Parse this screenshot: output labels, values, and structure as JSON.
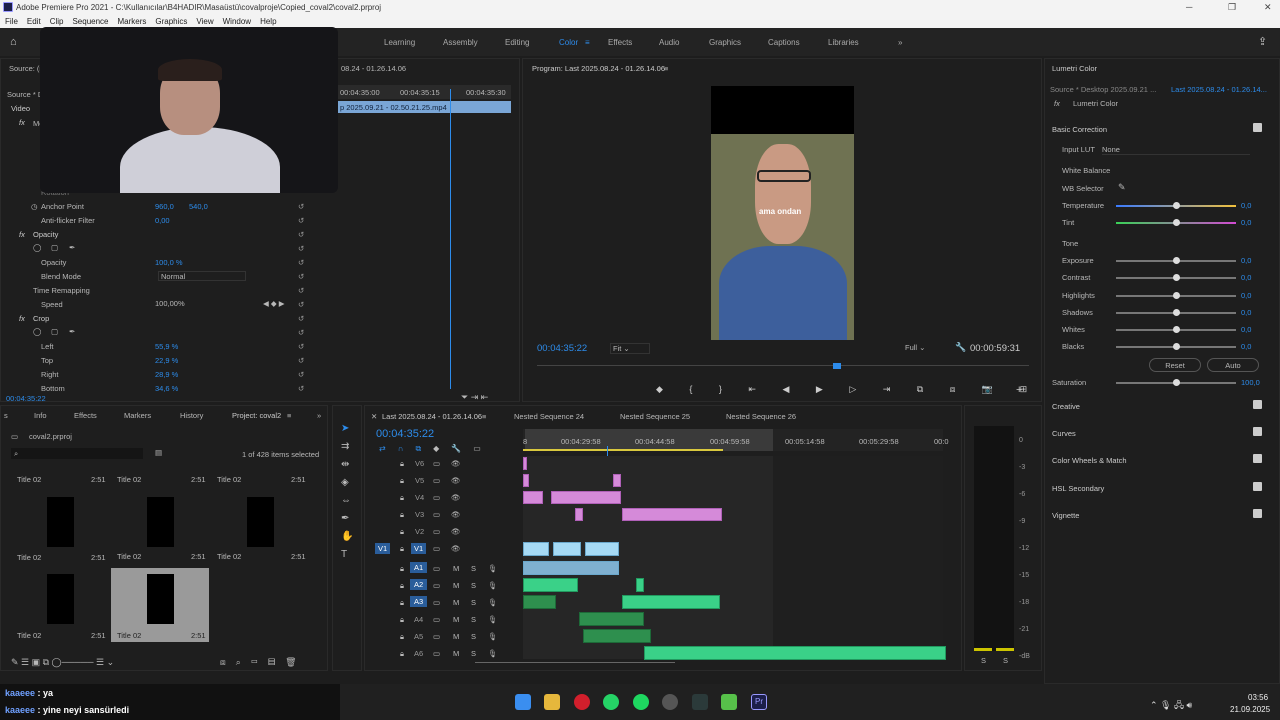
{
  "titlebar": {
    "title": "Adobe Premiere Pro 2021 - C:\\Kullanıcılar\\B4HADIR\\Masaüstü\\covalproje\\Copied_coval2\\coval2.prproj"
  },
  "menu": [
    "File",
    "Edit",
    "Clip",
    "Sequence",
    "Markers",
    "Graphics",
    "View",
    "Window",
    "Help"
  ],
  "workspaces": [
    "Learning",
    "Assembly",
    "Editing",
    "Color",
    "Effects",
    "Audio",
    "Graphics",
    "Captions",
    "Libraries"
  ],
  "effect_controls": {
    "source": "Source: (n",
    "source2": "Source * D",
    "video": "Video",
    "fx_motion": "Mo",
    "rotation": "Rotation",
    "anchor_point": "Anchor Point",
    "anchor_x": "960,0",
    "anchor_y": "540,0",
    "anti_flicker": "Anti-flicker Filter",
    "anti_flicker_val": "0,00",
    "opacity": "Opacity",
    "opacity_sub": "Opacity",
    "opacity_val": "100,0 %",
    "blend_mode": "Blend Mode",
    "blend_val": "Normal",
    "time_remap": "Time Remapping",
    "speed": "Speed",
    "speed_val": "100,00%",
    "crop": "Crop",
    "left": "Left",
    "left_val": "55,9 %",
    "top": "Top",
    "top_val": "22,9 %",
    "right": "Right",
    "right_val": "28,9 %",
    "bottom": "Bottom",
    "bottom_val": "34,6 %",
    "timecode": "00:04:35:22",
    "mini_tc": "08.24 - 01.26.14.06",
    "mini_t1": "00:04:35:00",
    "mini_t2": "00:04:35:15",
    "mini_t3": "00:04:35:30",
    "mini_clip": "p 2025.09.21 - 02.50.21.25.mp4"
  },
  "program": {
    "title": "Program: Last 2025.08.24 - 01.26.14.06",
    "caption": "ama ondan",
    "timecode": "00:04:35:22",
    "fit": "Fit",
    "quality": "Full",
    "duration": "00:00:59:31"
  },
  "lumetri": {
    "title": "Lumetri Color",
    "source": "Source * Desktop 2025.09.21 ...",
    "seq": "Last 2025.08.24 - 01.26.14...",
    "effect": "Lumetri Color",
    "basic": "Basic Correction",
    "lut": "Input LUT",
    "lut_val": "None",
    "wb": "White Balance",
    "wb_sel": "WB Selector",
    "temperature": "Temperature",
    "temp_val": "0,0",
    "tint": "Tint",
    "tint_val": "0,0",
    "tone": "Tone",
    "exposure": "Exposure",
    "exposure_val": "0,0",
    "contrast": "Contrast",
    "contrast_val": "0,0",
    "highlights": "Highlights",
    "highlights_val": "0,0",
    "shadows": "Shadows",
    "shadows_val": "0,0",
    "whites": "Whites",
    "whites_val": "0,0",
    "blacks": "Blacks",
    "blacks_val": "0,0",
    "reset": "Reset",
    "auto": "Auto",
    "saturation": "Saturation",
    "saturation_val": "100,0",
    "sections": [
      "Creative",
      "Curves",
      "Color Wheels & Match",
      "HSL Secondary",
      "Vignette"
    ]
  },
  "project": {
    "tabs": [
      "s",
      "Info",
      "Effects",
      "Markers",
      "History",
      "Project: coval2"
    ],
    "file": "coval2.prproj",
    "count": "1 of 428 items selected",
    "items": [
      {
        "name": "Title 02",
        "dur": "2:51"
      },
      {
        "name": "Title 02",
        "dur": "2:51"
      },
      {
        "name": "Title 02",
        "dur": "2:51"
      },
      {
        "name": "Title 02",
        "dur": "2:51"
      },
      {
        "name": "Title 02",
        "dur": "2:51"
      },
      {
        "name": "Title 02",
        "dur": "2:51"
      },
      {
        "name": "Title 02",
        "dur": "2:51"
      },
      {
        "name": "Title 02",
        "dur": "2:51"
      }
    ]
  },
  "timeline": {
    "tabs": [
      "Last 2025.08.24 - 01.26.14.06",
      "Nested Sequence 24",
      "Nested Sequence 25",
      "Nested Sequence 26"
    ],
    "timecode": "00:04:35:22",
    "ruler": [
      "8",
      "00:04:29:58",
      "00:04:44:58",
      "00:04:59:58",
      "00:05:14:58",
      "00:05:29:58",
      "00:0"
    ],
    "video_tracks": [
      "V6",
      "V5",
      "V4",
      "V3",
      "V2",
      "V1"
    ],
    "audio_tracks": [
      "A1",
      "A2",
      "A3",
      "A4",
      "A5",
      "A6"
    ],
    "source_patch_v": "V1"
  },
  "meter": {
    "scale": [
      "0",
      "-3",
      "-6",
      "-9",
      "-12",
      "-15",
      "-18",
      "-21",
      "-dB"
    ],
    "s1": "S",
    "s2": "S"
  },
  "chat": [
    {
      "user": "kaaeee",
      "msg": "ya"
    },
    {
      "user": "kaaeee",
      "msg": "yine neyi sansürledi"
    }
  ],
  "taskbar": {
    "time": "03:56",
    "date": "21.09.2025"
  }
}
